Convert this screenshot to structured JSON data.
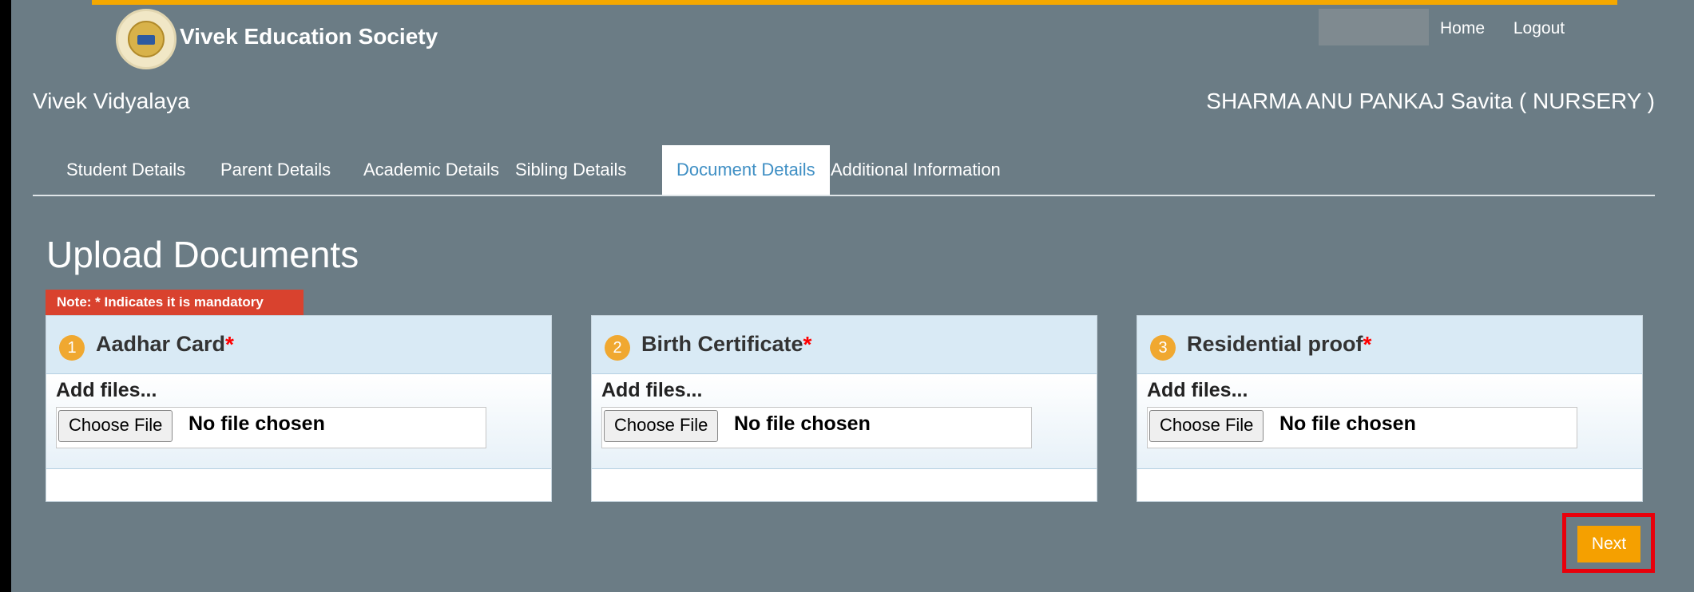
{
  "header": {
    "brand": "Vivek Education Society",
    "links": {
      "home": "Home",
      "logout": "Logout"
    },
    "school": "Vivek Vidyalaya",
    "student": "SHARMA ANU PANKAJ Savita ( NURSERY )"
  },
  "tabs": [
    {
      "label": "Student Details"
    },
    {
      "label": "Parent Details"
    },
    {
      "label": "Academic Details"
    },
    {
      "label": "Sibling Details"
    },
    {
      "label": "Document Details"
    },
    {
      "label": "Additional Information"
    }
  ],
  "page": {
    "title": "Upload Documents",
    "note": "Note: * Indicates it is mandatory"
  },
  "documents": [
    {
      "num": "1",
      "name": "Aadhar Card",
      "req": "*",
      "add": "Add files...",
      "button": "Choose File",
      "status": "No file chosen"
    },
    {
      "num": "2",
      "name": "Birth Certificate",
      "req": "*",
      "add": "Add files...",
      "button": "Choose File",
      "status": "No file chosen"
    },
    {
      "num": "3",
      "name": "Residential proof",
      "req": "*",
      "add": "Add files...",
      "button": "Choose File",
      "status": "No file chosen"
    }
  ],
  "actions": {
    "next": "Next"
  },
  "colors": {
    "background": "#6b7c85",
    "accent": "#f5a000",
    "tab_active_text": "#3f8fc4",
    "note_bg": "#d9422e",
    "highlight": "#e8000b"
  }
}
